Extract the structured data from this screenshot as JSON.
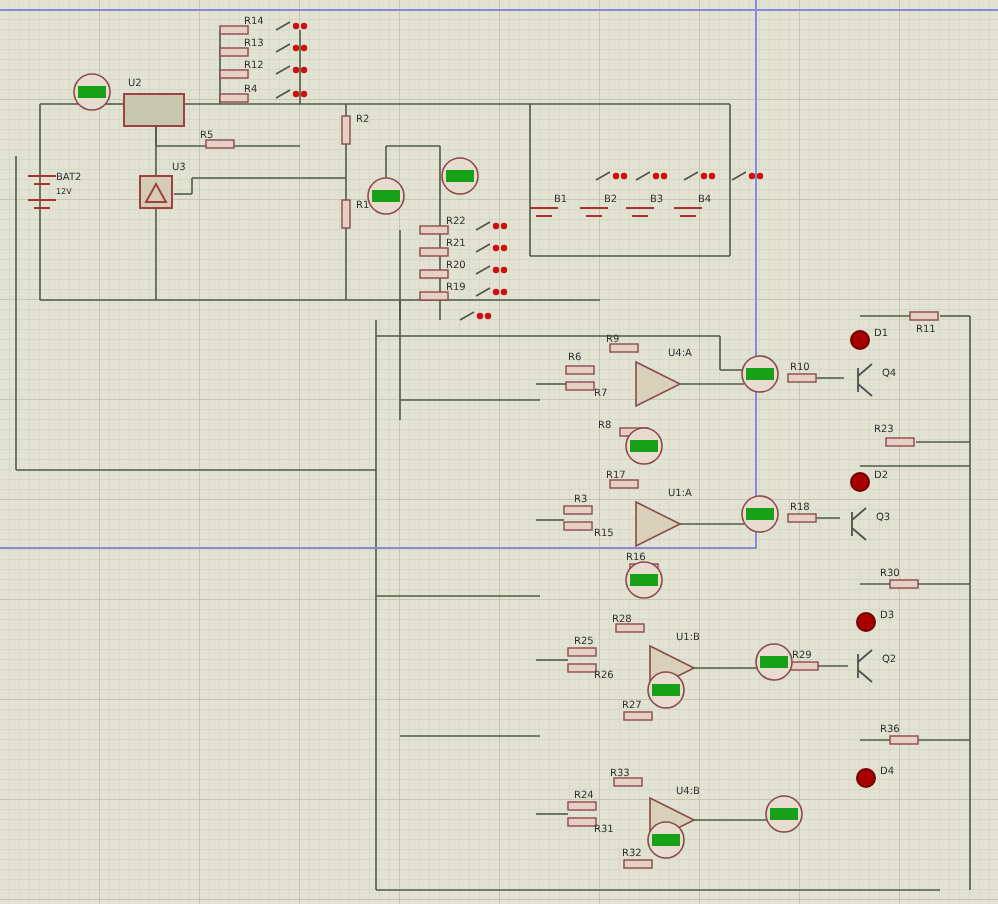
{
  "supply": {
    "ref": "BAT2",
    "voltage": "12V"
  },
  "regulator": {
    "ref": "U2"
  },
  "reference": {
    "ref": "U3"
  },
  "resistors": [
    {
      "ref": "R14"
    },
    {
      "ref": "R13"
    },
    {
      "ref": "R12"
    },
    {
      "ref": "R4"
    },
    {
      "ref": "R5"
    },
    {
      "ref": "R2"
    },
    {
      "ref": "R1"
    },
    {
      "ref": "R22"
    },
    {
      "ref": "R21"
    },
    {
      "ref": "R20"
    },
    {
      "ref": "R19"
    },
    {
      "ref": "R9"
    },
    {
      "ref": "R6"
    },
    {
      "ref": "R7"
    },
    {
      "ref": "R8"
    },
    {
      "ref": "R10"
    },
    {
      "ref": "R11"
    },
    {
      "ref": "R23"
    },
    {
      "ref": "R17"
    },
    {
      "ref": "R3"
    },
    {
      "ref": "R15"
    },
    {
      "ref": "R16"
    },
    {
      "ref": "R18"
    },
    {
      "ref": "R30"
    },
    {
      "ref": "R28"
    },
    {
      "ref": "R25"
    },
    {
      "ref": "R26"
    },
    {
      "ref": "R27"
    },
    {
      "ref": "R29"
    },
    {
      "ref": "R36"
    },
    {
      "ref": "R33"
    },
    {
      "ref": "R24"
    },
    {
      "ref": "R31"
    },
    {
      "ref": "R32"
    }
  ],
  "batteries": [
    {
      "ref": "B1"
    },
    {
      "ref": "B2"
    },
    {
      "ref": "B3"
    },
    {
      "ref": "B4"
    }
  ],
  "opamps": [
    {
      "ref": "U4:A"
    },
    {
      "ref": "U1:A"
    },
    {
      "ref": "U1:B"
    },
    {
      "ref": "U4:B"
    }
  ],
  "leds": [
    {
      "ref": "D1"
    },
    {
      "ref": "D2"
    },
    {
      "ref": "D3"
    },
    {
      "ref": "D4"
    }
  ],
  "transistors": [
    {
      "ref": "Q4"
    },
    {
      "ref": "Q3"
    },
    {
      "ref": "Q2"
    }
  ]
}
